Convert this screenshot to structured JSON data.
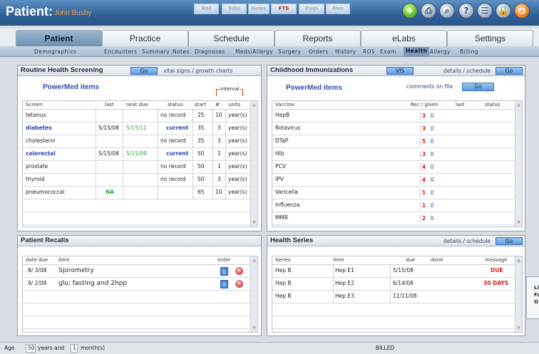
{
  "header": {
    "title": "Patient:",
    "patient_name": "John Busby",
    "buttons": [
      "Mail",
      "ToDo",
      "Notes",
      "FTS",
      "Flags",
      "Files"
    ]
  },
  "icons": [
    "plus-icon",
    "print-icon",
    "search-icon",
    "help-icon",
    "list-icon",
    "lock-icon",
    "exit-icon"
  ],
  "tabs": [
    "Patient",
    "Practice",
    "Schedule",
    "Reports",
    "eLabs",
    "Settings"
  ],
  "subnav": [
    "Demographics",
    "Encounters",
    "Summary",
    "Notes",
    "Diagnoses",
    "Meds/Allergy",
    "Surgery",
    "Orders",
    "History",
    "ROS",
    "Exam",
    "Health",
    "Allergy",
    "Billing"
  ],
  "screening": {
    "title": "Routine Health Screening",
    "go": "Go",
    "vitals_link": "vital signs / growth charts",
    "powermed": "PowerMed items",
    "interval": "interval",
    "columns": [
      "Screen",
      "last",
      "next due",
      "status",
      "start",
      "#",
      "units"
    ],
    "rows": [
      {
        "screen": "tetanus",
        "last": "",
        "next": "",
        "status": "no record",
        "start": "25",
        "num": "10",
        "units": "year(s)",
        "style": ""
      },
      {
        "screen": "diabetes",
        "last": "5/15/08",
        "next": "5/15/11",
        "status": "current",
        "start": "35",
        "num": "3",
        "units": "year(s)",
        "style": "blue"
      },
      {
        "screen": "cholesterol",
        "last": "",
        "next": "",
        "status": "no record",
        "start": "35",
        "num": "3",
        "units": "year(s)",
        "style": ""
      },
      {
        "screen": "colorectal",
        "last": "5/15/08",
        "next": "5/15/09",
        "status": "current",
        "start": "50",
        "num": "1",
        "units": "year(s)",
        "style": "blue"
      },
      {
        "screen": "prostate",
        "last": "",
        "next": "",
        "status": "no record",
        "start": "50",
        "num": "1",
        "units": "year(s)",
        "style": ""
      },
      {
        "screen": "thyroid",
        "last": "",
        "next": "",
        "status": "no record",
        "start": "50",
        "num": "3",
        "units": "year(s)",
        "style": ""
      },
      {
        "screen": "pneumococcal",
        "last": "NA",
        "next": "",
        "status": "",
        "start": "65",
        "num": "10",
        "units": "year(s)",
        "style": ""
      }
    ]
  },
  "immunizations": {
    "title": "Childhood Immunizations",
    "vis": "VIS",
    "details": "details / schedule",
    "go": "Go",
    "powermed": "PowerMed items",
    "comments": "comments on file",
    "comments_go": "Go",
    "columns": [
      "Vaccine",
      "Rec / given",
      "last",
      "status"
    ],
    "rows": [
      {
        "vaccine": "HepB",
        "rec": "3",
        "given": "0"
      },
      {
        "vaccine": "Rotavirus",
        "rec": "3",
        "given": "0"
      },
      {
        "vaccine": "DTaP",
        "rec": "5",
        "given": "0"
      },
      {
        "vaccine": "Hib",
        "rec": "3",
        "given": "0"
      },
      {
        "vaccine": "PCV",
        "rec": "4",
        "given": "0"
      },
      {
        "vaccine": "IPV",
        "rec": "4",
        "given": "0"
      },
      {
        "vaccine": "Varicella",
        "rec": "1",
        "given": "0"
      },
      {
        "vaccine": "Influenza",
        "rec": "1",
        "given": "0"
      },
      {
        "vaccine": "MMR",
        "rec": "2",
        "given": "0"
      }
    ]
  },
  "recalls": {
    "title": "Patient Recalls",
    "columns": [
      "date due",
      "item",
      "order"
    ],
    "rows": [
      {
        "date": "8/ 3/08",
        "item": "Spirometry",
        "order": "0"
      },
      {
        "date": "9/ 2/08",
        "item": "glu; fasting and 2hpp",
        "order": "0"
      }
    ]
  },
  "series": {
    "title": "Health Series",
    "details": "details / schedule",
    "go": "Go",
    "columns": [
      "Series",
      "item",
      "due",
      "done",
      "message"
    ],
    "rows": [
      {
        "series": "Hep B",
        "item": "Hep E1",
        "due": "5/15/08",
        "done": "",
        "message": "DUE"
      },
      {
        "series": "Hep B",
        "item": "Hep E2",
        "due": "6/14/08",
        "done": "",
        "message": "30 DAYS"
      },
      {
        "series": "Hep B",
        "item": "Hep E3",
        "due": "11/11/08",
        "done": "",
        "message": ""
      }
    ]
  },
  "side_popup": [
    "Li",
    "Fa",
    "O"
  ],
  "status": {
    "age_label": "Age",
    "years": "50",
    "years_label": "years and",
    "months": "1",
    "months_label": "month(s)",
    "billed": "BILLED"
  }
}
